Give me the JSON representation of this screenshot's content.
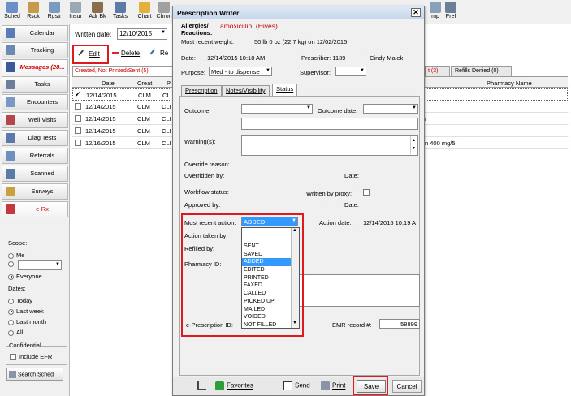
{
  "toolbar": {
    "buttons": [
      {
        "label": "Sched",
        "icon": "schedule-icon"
      },
      {
        "label": "Rsck",
        "icon": "stack-icon"
      },
      {
        "label": "Rgstr",
        "icon": "register-icon"
      },
      {
        "label": "Insur",
        "icon": "insurance-icon"
      },
      {
        "label": "Adr Bk",
        "icon": "address-book-icon"
      },
      {
        "label": "Tasks",
        "icon": "tasks-icon"
      },
      {
        "label": "Chart",
        "icon": "chart-icon"
      },
      {
        "label": "Chron",
        "icon": "chronology-icon"
      },
      {
        "label": "mp",
        "icon": "template-icon"
      },
      {
        "label": "Pref",
        "icon": "preferences-icon"
      }
    ]
  },
  "leftnav": {
    "items": [
      {
        "label": "Calendar"
      },
      {
        "label": "Tracking"
      },
      {
        "label": "Messages (28..."
      },
      {
        "label": "Tasks"
      },
      {
        "label": "Encounters"
      },
      {
        "label": "Well Visits"
      },
      {
        "label": "Diag Tests"
      },
      {
        "label": "Referrals"
      },
      {
        "label": "Scanned"
      },
      {
        "label": "Surveys"
      },
      {
        "label": "e-Rx"
      }
    ],
    "scope_label": "Scope:",
    "scope_me": "Me",
    "scope_everyone": "Everyone",
    "dates_label": "Dates:",
    "date_today": "Today",
    "date_last_week": "Last week",
    "date_last_month": "Last month",
    "date_all": "All",
    "confidential_label": "Confidential",
    "include_efr": "Include EFR",
    "search_sched": "Search Sched"
  },
  "main": {
    "written_date_label": "Written date:",
    "written_date_value": "12/10/2015",
    "edit_label": "Edit",
    "delete_label": "Delete",
    "re_label": "Re",
    "tab_created": "Created, Not Printed/Sent (5)",
    "tab_t_suffix": "t (3)",
    "tab_refills_denied": "Refills Denied (0)",
    "col_date": "Date",
    "col_creat": "Creat",
    "col_p": "P",
    "col_pharmacy": "Pharmacy Name",
    "rows": [
      {
        "date": "12/14/2015",
        "creat": "CLM",
        "p": "CLI",
        "extra": ""
      },
      {
        "date": "12/14/2015",
        "creat": "CLM",
        "p": "CLI",
        "extra": ""
      },
      {
        "date": "12/14/2015",
        "creat": "CLM",
        "p": "CLI",
        "extra": "r"
      },
      {
        "date": "12/14/2015",
        "creat": "CLM",
        "p": "CLI",
        "extra": ""
      },
      {
        "date": "12/16/2015",
        "creat": "CLM",
        "p": "CLI",
        "extra": "n 400 mg/5"
      }
    ]
  },
  "dialog": {
    "title": "Prescription Writer",
    "allergies_label": "Allergies/ Reactions:",
    "allergies_value": "amoxicillin: (Hives)",
    "weight_label": "Most recent weight:",
    "weight_value": "50 lb 0 oz (22.7 kg) on 12/02/2015",
    "date_label": "Date:",
    "date_value": "12/14/2015 10:18 AM",
    "prescriber_label": "Prescriber: 1139",
    "prescriber_name": "Cindy Malek",
    "purpose_label": "Purpose:",
    "purpose_value": "Med - to dispense",
    "supervisor_label": "Supervisor:",
    "tabs": [
      {
        "label": "Prescription"
      },
      {
        "label": "Notes/Visibility"
      },
      {
        "label": "Status"
      }
    ],
    "outcome_label": "Outcome:",
    "outcome_date_label": "Outcome date:",
    "warnings_label": "Warning(s):",
    "override_reason_label": "Override reason:",
    "overridden_by_label": "Overridden by:",
    "date_short_label": "Date:",
    "workflow_status_label": "Workflow status:",
    "written_by_proxy_label": "Written by proxy:",
    "approved_by_label": "Approved by:",
    "most_recent_action_label": "Most recent action:",
    "most_recent_action_value": "ADDED",
    "action_date_label": "Action date:",
    "action_date_value": "12/14/2015 10:19 A",
    "action_taken_by_label": "Action taken by:",
    "refilled_by_label": "Refilled by:",
    "pharmacy_id_label": "Pharmacy ID:",
    "eprescription_id_label": "e-Prescription ID:",
    "emr_record_label": "EMR record #:",
    "emr_record_value": "58899",
    "action_options": [
      "SENT",
      "SAVED",
      "ADDED",
      "EDITED",
      "PRINTED",
      "FAXED",
      "CALLED",
      "PICKED UP",
      "MAILED",
      "VOIDED",
      "NOT FILLED"
    ],
    "selected_option": "ADDED",
    "btn_favorites": "Favorites",
    "btn_send": "Send",
    "btn_print": "Print",
    "btn_save": "Save",
    "btn_cancel": "Cancel"
  },
  "colors": {
    "highlight_red": "#e0191c",
    "allergy_red": "#cc0000",
    "selection_blue": "#3399ff"
  }
}
